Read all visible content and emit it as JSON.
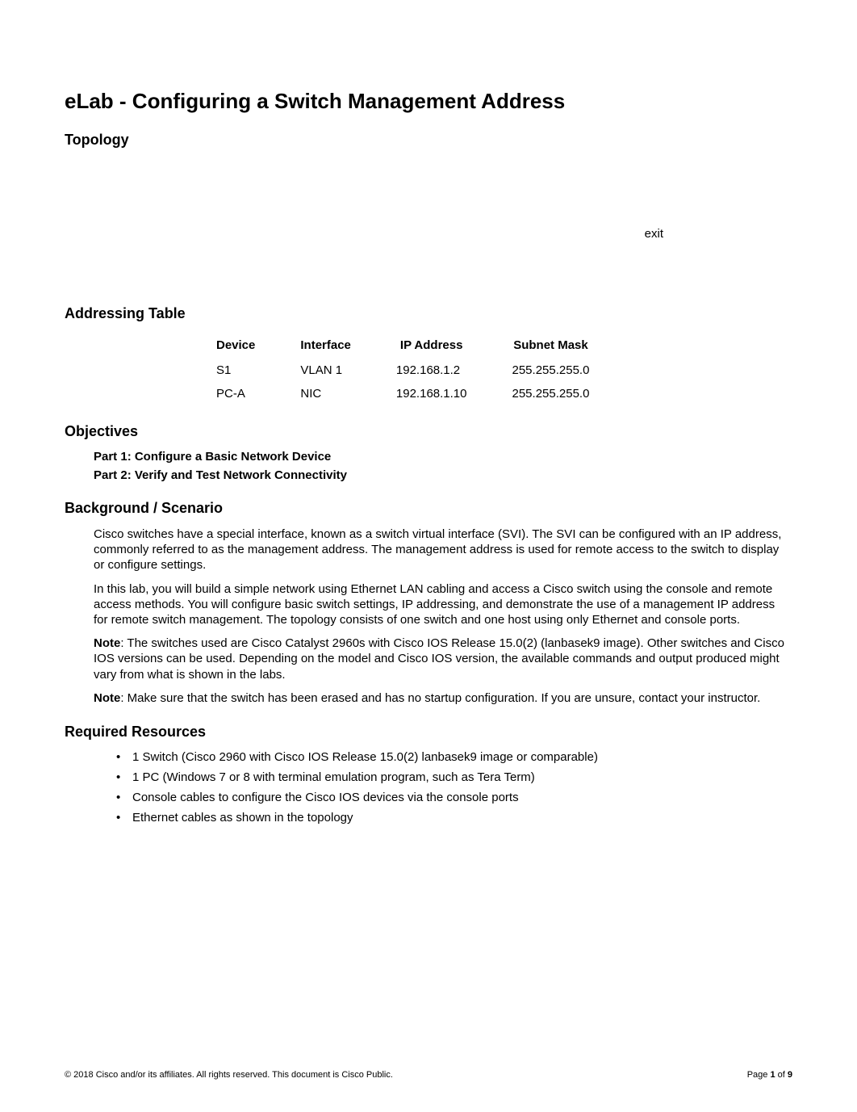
{
  "title": "eLab - Configuring a Switch Management Address",
  "sections": {
    "topology_heading": "Topology",
    "addressing_heading": "Addressing Table",
    "objectives_heading": "Objectives",
    "background_heading": "Background / Scenario",
    "resources_heading": "Required Resources"
  },
  "topology": {
    "exit_text": "exit"
  },
  "addressing_table": {
    "headers": [
      "Device",
      "Interface",
      "IP Address",
      "Subnet Mask"
    ],
    "rows": [
      [
        "S1",
        "VLAN 1",
        "192.168.1.2",
        "255.255.255.0"
      ],
      [
        "PC-A",
        "NIC",
        "192.168.1.10",
        "255.255.255.0"
      ]
    ]
  },
  "objectives": {
    "items": [
      "Part 1: Configure a Basic Network Device",
      "Part 2: Verify and Test Network Connectivity"
    ]
  },
  "background": {
    "paragraphs": [
      {
        "prefix": "",
        "text": "Cisco switches have a special interface, known as a switch virtual interface (SVI). The SVI can be configured with an IP address, commonly referred to as the management address. The management address is used for remote access to the switch to display or configure settings."
      },
      {
        "prefix": "",
        "text": "In this lab, you will build a simple network using Ethernet LAN cabling and access a Cisco switch using the console and remote access methods. You will configure basic switch settings, IP addressing, and demonstrate the use of a management IP address for remote switch management. The topology consists of one switch and one host using only Ethernet and console ports."
      },
      {
        "prefix": "Note",
        "text": ": The switches used are Cisco Catalyst 2960s with Cisco IOS Release 15.0(2) (lanbasek9 image). Other switches and Cisco IOS versions can be used. Depending on the model and Cisco IOS version, the available commands and output produced might vary from what is shown in the labs."
      },
      {
        "prefix": "Note",
        "text": ": Make sure that the switch has been erased and has no startup configuration. If you are unsure, contact your instructor."
      }
    ]
  },
  "resources": {
    "items": [
      "1 Switch (Cisco 2960 with Cisco IOS Release 15.0(2) lanbasek9 image or comparable)",
      "1 PC (Windows 7 or 8 with terminal emulation program, such as Tera Term)",
      "Console cables to configure the Cisco IOS devices via the console ports",
      "Ethernet cables as shown in the topology"
    ]
  },
  "footer": {
    "copyright": "© 2018 Cisco and/or its affiliates. All rights reserved. This document is Cisco Public.",
    "page_prefix": "Page ",
    "page_current": "1",
    "page_of": " of ",
    "page_total": "9"
  }
}
